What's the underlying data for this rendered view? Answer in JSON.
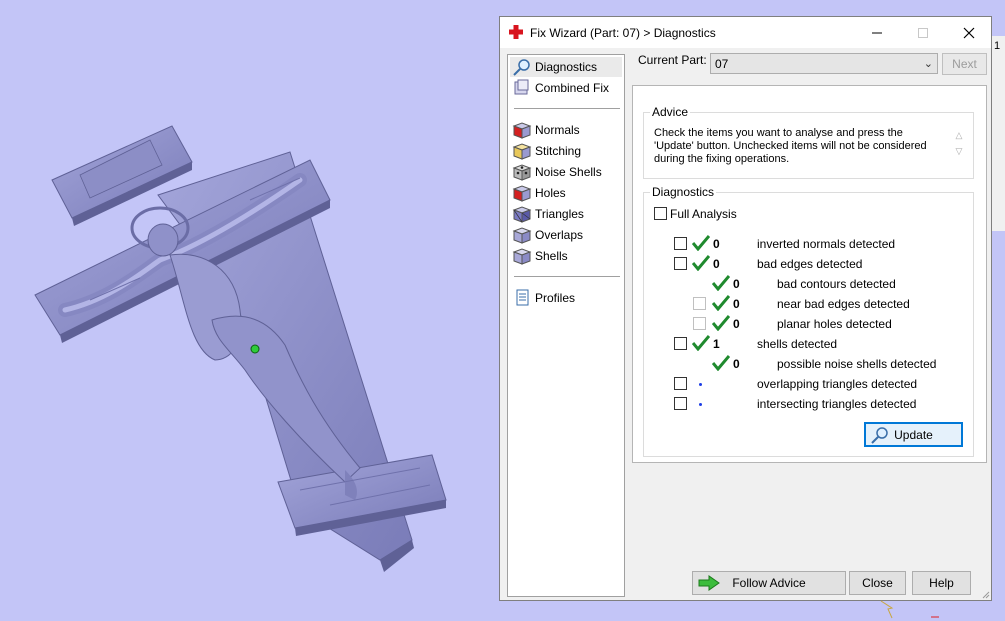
{
  "window": {
    "title": "Fix Wizard (Part: 07) > Diagnostics",
    "side_label": "1"
  },
  "nav": {
    "items": [
      {
        "label": "Diagnostics",
        "icon": "magnifier-icon"
      },
      {
        "label": "Combined Fix",
        "icon": "combined-fix-icon"
      },
      {
        "label": "Normals",
        "icon": "normals-cube-icon"
      },
      {
        "label": "Stitching",
        "icon": "stitching-cube-icon"
      },
      {
        "label": "Noise Shells",
        "icon": "noise-shells-cube-icon"
      },
      {
        "label": "Holes",
        "icon": "holes-cube-icon"
      },
      {
        "label": "Triangles",
        "icon": "triangles-cube-icon"
      },
      {
        "label": "Overlaps",
        "icon": "overlaps-cube-icon"
      },
      {
        "label": "Shells",
        "icon": "shells-cube-icon"
      },
      {
        "label": "Profiles",
        "icon": "profiles-document-icon"
      }
    ]
  },
  "header": {
    "current_part_label": "Current Part:",
    "current_part_value": "07",
    "next_label": "Next"
  },
  "advice": {
    "legend": "Advice",
    "text": "Check the items you want to analyse and press the 'Update' button. Unchecked items will not be considered during the fixing operations."
  },
  "diagnostics": {
    "legend": "Diagnostics",
    "full_analysis_label": "Full Analysis",
    "rows": [
      {
        "label": "inverted normals detected",
        "count": "0"
      },
      {
        "label": "bad edges detected",
        "count": "0"
      },
      {
        "label": "bad contours detected",
        "count": "0"
      },
      {
        "label": "near bad edges detected",
        "count": "0"
      },
      {
        "label": "planar holes detected",
        "count": "0"
      },
      {
        "label": "shells detected",
        "count": "1"
      },
      {
        "label": "possible noise shells detected",
        "count": "0"
      },
      {
        "label": "overlapping triangles detected",
        "count": ""
      },
      {
        "label": "intersecting triangles detected",
        "count": ""
      }
    ],
    "update_label": "Update"
  },
  "footer": {
    "follow_advice_label": "Follow Advice",
    "close_label": "Close",
    "help_label": "Help"
  },
  "colors": {
    "viewport_background": "#c3c5f7",
    "model_color": "#8e90c8",
    "check_green": "#1f8a2e",
    "accent_blue": "#0078d7"
  }
}
